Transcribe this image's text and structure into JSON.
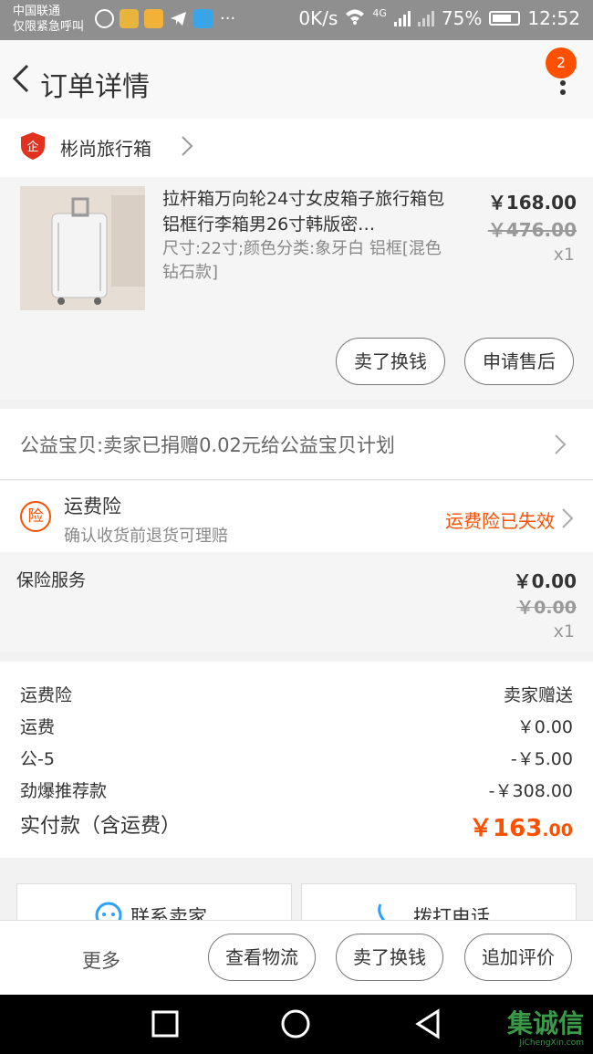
{
  "status_bar": {
    "carrier_line1": "中国联通",
    "carrier_line2": "仅限紧急呼叫",
    "speed": "0K/s",
    "network": "4G",
    "battery": "75%",
    "time": "12:52"
  },
  "header": {
    "title": "订单详情",
    "badge_count": "2"
  },
  "shop": {
    "name": "彬尚旅行箱",
    "icon": "enterprise-shield-icon"
  },
  "product": {
    "title": "拉杆箱万向轮24寸女皮箱子旅行箱包铝框行李箱男26寸韩版密…",
    "sku": "尺寸:22寸;颜色分类:象牙白 铝框[混色钻石款]",
    "price": "￥168.00",
    "original_price": "￥476.00",
    "quantity": "x1",
    "actions": [
      "卖了换钱",
      "申请售后"
    ]
  },
  "charity": {
    "text": "公益宝贝:卖家已捐赠0.02元给公益宝贝计划"
  },
  "insurance": {
    "icon_label": "险",
    "title": "运费险",
    "subtitle": "确认收货前退货可理赔",
    "status": "运费险已失效"
  },
  "insurance_service": {
    "name": "保险服务",
    "price": "￥0.00",
    "original_price": "￥0.00",
    "quantity": "x1"
  },
  "summary": {
    "rows": [
      {
        "label": "运费险",
        "value": "卖家赠送"
      },
      {
        "label": "运费",
        "value": "￥0.00"
      },
      {
        "label": "公-5",
        "value": "-￥5.00"
      },
      {
        "label": "劲爆推荐款",
        "value": "-￥308.00"
      }
    ],
    "total_label": "实付款（含运费）",
    "total_int": "￥163",
    "total_dec": ".00"
  },
  "contact": {
    "seller_label": "联系卖家",
    "call_label": "拨打电话"
  },
  "bottom_bar": {
    "more": "更多",
    "buttons": [
      "查看物流",
      "卖了换钱",
      "追加评价"
    ]
  },
  "watermark": {
    "text": "集诚信",
    "sub": "JiChengXin.com"
  },
  "colors": {
    "accent": "#ff5000",
    "status_bar": "#8f8f8f"
  }
}
